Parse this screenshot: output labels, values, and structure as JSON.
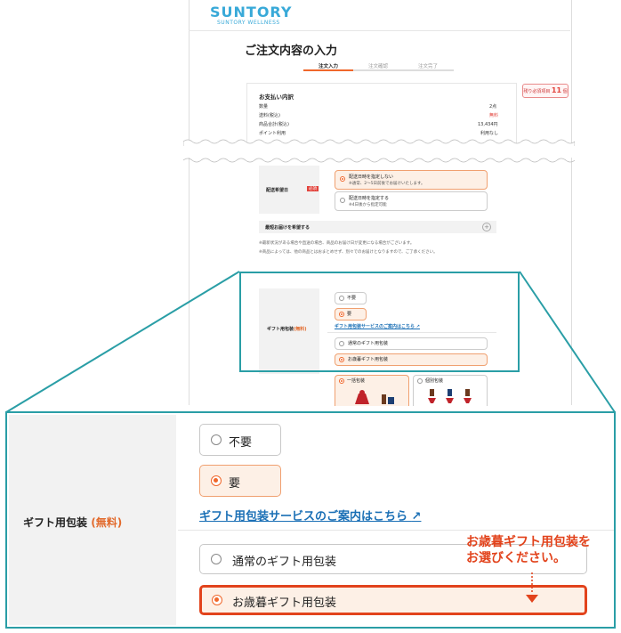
{
  "header": {
    "brand": "SUNTORY",
    "brand_sub": "SUNTORY WELLNESS"
  },
  "page_title": "ご注文内容の入力",
  "steps": [
    {
      "label": "注文入力",
      "active": true
    },
    {
      "label": "注文確認",
      "active": false
    },
    {
      "label": "注文完了",
      "active": false
    }
  ],
  "payment": {
    "heading": "お支払い内訳",
    "rows": [
      {
        "label": "数量",
        "value": "2点"
      },
      {
        "label": "送料(税込)",
        "value": "無料"
      },
      {
        "label": "商品合計(税込)",
        "value": "13,434円"
      },
      {
        "label": "ポイント利用",
        "value": "利用なし"
      }
    ]
  },
  "days_badge": {
    "prefix": "残り必須項目",
    "count": "11",
    "suffix": "個"
  },
  "delivery": {
    "label": "配送希望日",
    "required": "必須",
    "option1_title": "配送日時を指定しない",
    "option1_note": "※通常、2〜5日前後でお届けいたします。",
    "option2_title": "配送日時を指定する",
    "option2_note": "※4日後から指定可能",
    "neighbor_label": "最短お届けを希望する",
    "note1": "※最新状況がある場合や直送の場合、商品のお届け日が変更になる場合がございます。",
    "note2": "※商品によっては、他の商品とはおまとめせず、別々でのお届けとなりますので、ご了承ください。"
  },
  "gift": {
    "label": "ギフト用包装",
    "free": "(無料)",
    "no": "不要",
    "yes": "要",
    "link": "ギフト用包装サービスのご案内はこちら",
    "type_normal": "通常のギフト用包装",
    "type_seibo": "お歳暮ギフト用包装",
    "pack_bundle": "一括包装",
    "pack_individual": "個別包装"
  },
  "callout": {
    "line1": "お歳暮ギフト用包装を",
    "line2": "お選びください。"
  },
  "colors": {
    "accent": "#f0672b",
    "brand": "#38a9d8",
    "teal": "#2a9ea6",
    "link": "#1a6fb5"
  }
}
